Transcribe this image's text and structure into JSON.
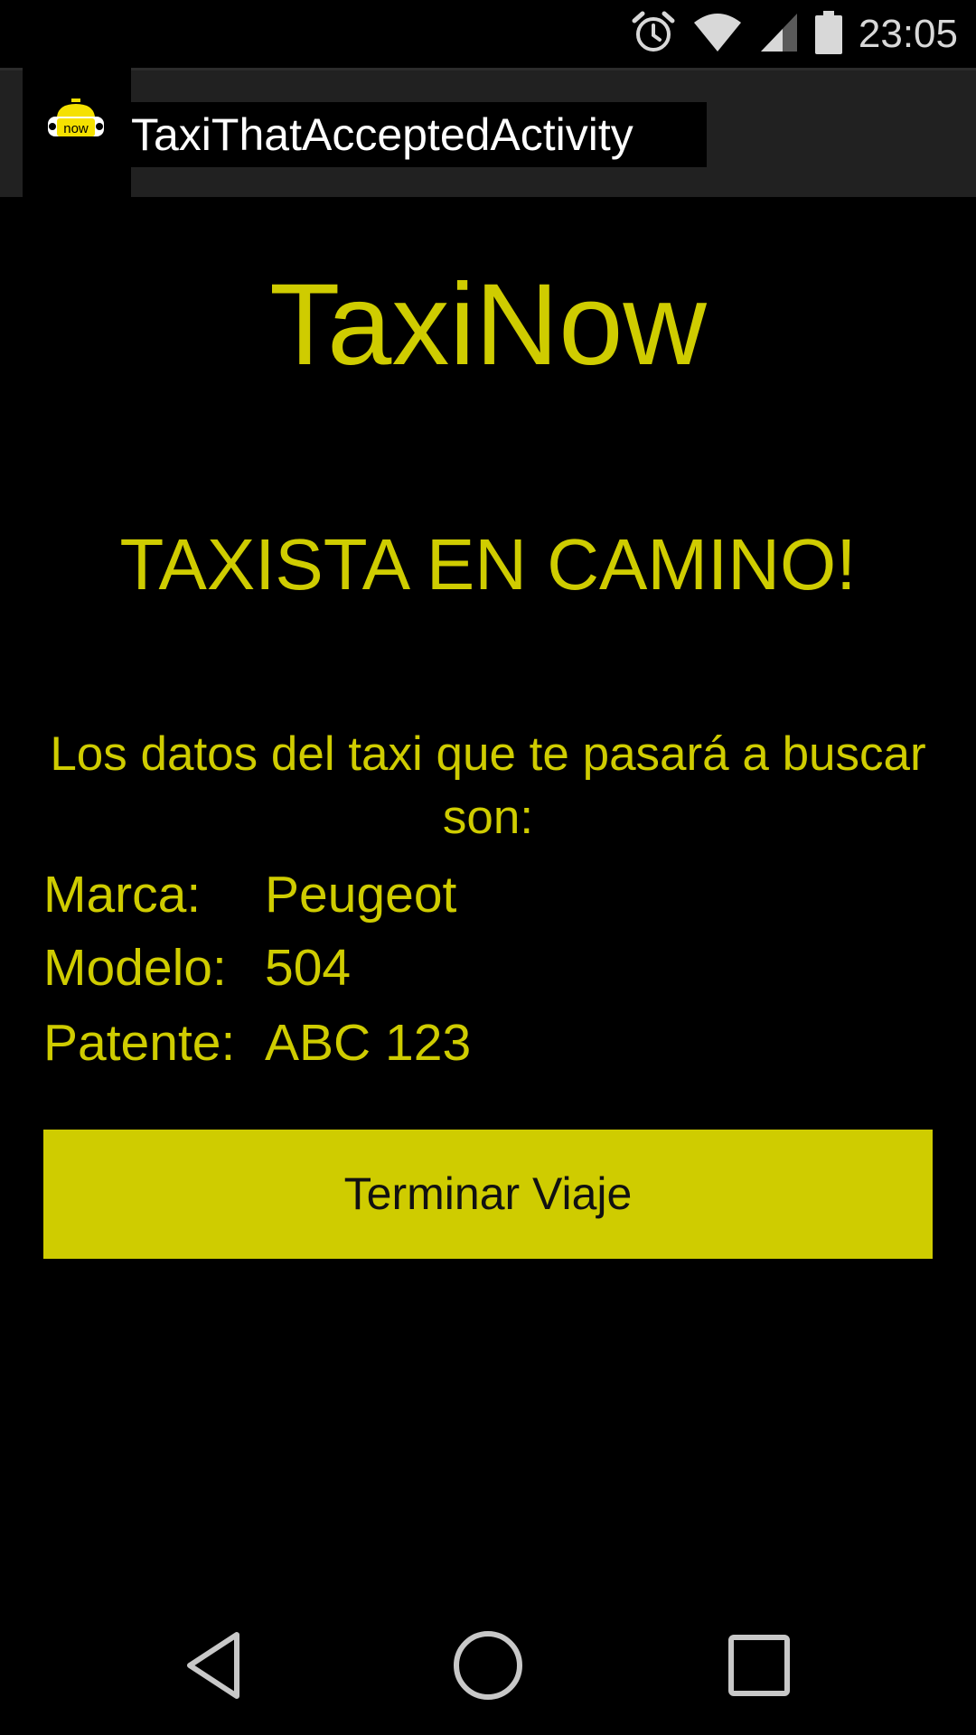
{
  "status_bar": {
    "time": "23:05",
    "icons": [
      "alarm-icon",
      "wifi-icon",
      "cell-signal-icon",
      "battery-icon"
    ]
  },
  "action_bar": {
    "app_icon_text": "now",
    "title": "TaxiThatAcceptedActivity"
  },
  "main": {
    "brand": "TaxiNow",
    "heading": "TAXISTA EN CAMINO!",
    "intro": "Los datos del taxi que te pasará a buscar son:",
    "details": [
      {
        "label": "Marca:",
        "value": "Peugeot"
      },
      {
        "label": "Modelo:",
        "value": "504"
      },
      {
        "label": "Patente:",
        "value": "ABC 123"
      }
    ],
    "button_label": "Terminar Viaje"
  },
  "nav_bar": {
    "buttons": [
      "back-icon",
      "home-icon",
      "recents-icon"
    ]
  },
  "colors": {
    "accent": "#cfcc00",
    "background": "#000000",
    "action_bar": "#212121"
  }
}
